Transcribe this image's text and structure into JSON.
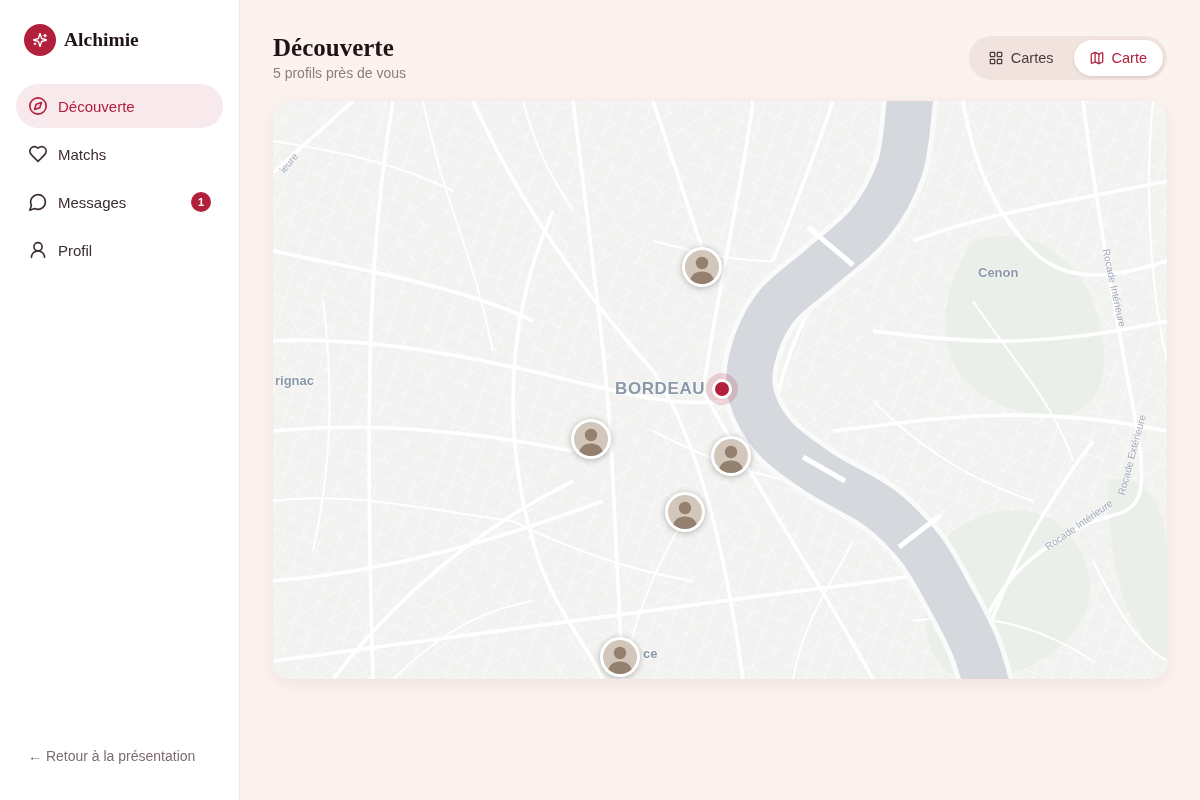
{
  "sidebar": {
    "brand": "Alchimie",
    "nav": [
      {
        "label": "Découverte",
        "selected": true
      },
      {
        "label": "Matchs",
        "selected": false
      },
      {
        "label": "Messages",
        "selected": false,
        "badge": "1"
      },
      {
        "label": "Profil",
        "selected": false
      }
    ],
    "back_link": "← Retour à la présentation"
  },
  "header": {
    "title": "Découverte",
    "subtitle": "5 profils près de vous"
  },
  "view_toggle": [
    {
      "label": "Cartes",
      "selected": false
    },
    {
      "label": "Carte",
      "selected": true
    }
  ],
  "map": {
    "labels": [
      {
        "kind": "road",
        "text": "ieure"
      },
      {
        "kind": "road",
        "text": "Rocade Intérieure"
      },
      {
        "kind": "town",
        "text": "Cenon"
      },
      {
        "kind": "town",
        "text": "rignac"
      },
      {
        "kind": "city",
        "text": "BORDEAU"
      },
      {
        "kind": "road",
        "text": "Rocade Extérieure"
      },
      {
        "kind": "road",
        "text": "Rocade Intérieure"
      },
      {
        "kind": "town",
        "text": "ce"
      }
    ],
    "markers": [
      {
        "kind": "profile"
      },
      {
        "kind": "you"
      },
      {
        "kind": "profile"
      },
      {
        "kind": "profile"
      },
      {
        "kind": "profile"
      },
      {
        "kind": "profile"
      }
    ]
  }
}
